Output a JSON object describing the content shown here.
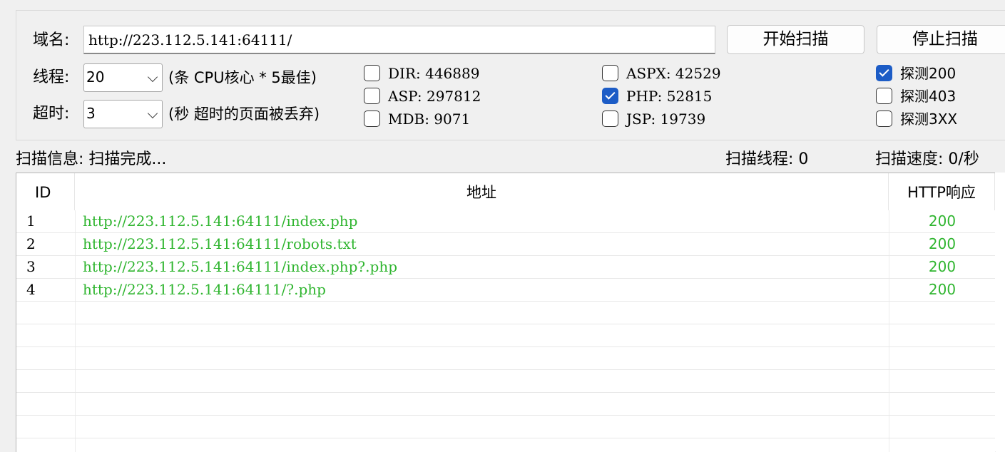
{
  "config": {
    "domain_label": "域名:",
    "domain_value": "http://223.112.5.141:64111/",
    "start_button": "开始扫描",
    "stop_button": "停止扫描",
    "threads_label": "线程:",
    "threads_value": "20",
    "threads_hint": "(条 CPU核心 * 5最佳)",
    "timeout_label": "超时:",
    "timeout_value": "3",
    "timeout_hint": "(秒 超时的页面被丢弃)"
  },
  "dictionaries": [
    {
      "label": "DIR: 446889",
      "checked": false
    },
    {
      "label": "ASP: 297812",
      "checked": false
    },
    {
      "label": "MDB: 9071",
      "checked": false
    },
    {
      "label": "ASPX: 42529",
      "checked": false
    },
    {
      "label": "PHP: 52815",
      "checked": true
    },
    {
      "label": "JSP: 19739",
      "checked": false
    }
  ],
  "detect": [
    {
      "label": "探测200",
      "checked": true
    },
    {
      "label": "探测403",
      "checked": false
    },
    {
      "label": "探测3XX",
      "checked": false
    }
  ],
  "status": {
    "info": "扫描信息: 扫描完成...",
    "threads": "扫描线程: 0",
    "speed": "扫描速度: 0/秒"
  },
  "results": {
    "columns": [
      "ID",
      "地址",
      "HTTP响应"
    ],
    "rows": [
      {
        "id": "1",
        "url": "http://223.112.5.141:64111/index.php",
        "code": "200"
      },
      {
        "id": "2",
        "url": "http://223.112.5.141:64111/robots.txt",
        "code": "200"
      },
      {
        "id": "3",
        "url": "http://223.112.5.141:64111/index.php?.php",
        "code": "200"
      },
      {
        "id": "4",
        "url": "http://223.112.5.141:64111/?.php",
        "code": "200"
      }
    ]
  },
  "colors": {
    "accent": "#1c5cc6",
    "success_text": "#2fb52f"
  }
}
